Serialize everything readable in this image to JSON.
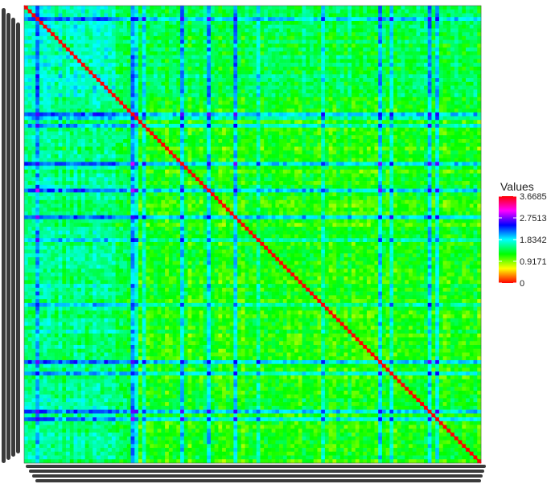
{
  "chart_data": {
    "type": "heatmap",
    "title": "",
    "xlabel": "",
    "ylabel": "",
    "diagonal_value": 0,
    "value_range": [
      0,
      3.6685
    ],
    "colorscale": [
      "#ff0000",
      "#ffff00",
      "#00ff00",
      "#00ffff",
      "#0000ff",
      "#ff00ff",
      "#ff0000"
    ],
    "legend": {
      "title": "Values",
      "ticks": [
        "3.6685",
        "2.7513",
        "1.8342",
        "0.9171",
        "0"
      ],
      "tick_values": [
        3.6685,
        2.7513,
        1.8342,
        0.9171,
        0
      ],
      "placement": "right"
    },
    "row_labels_legible": false,
    "column_labels_legible": false,
    "notes": "Symmetric distance matrix; axis tick labels are illegibly dense."
  }
}
